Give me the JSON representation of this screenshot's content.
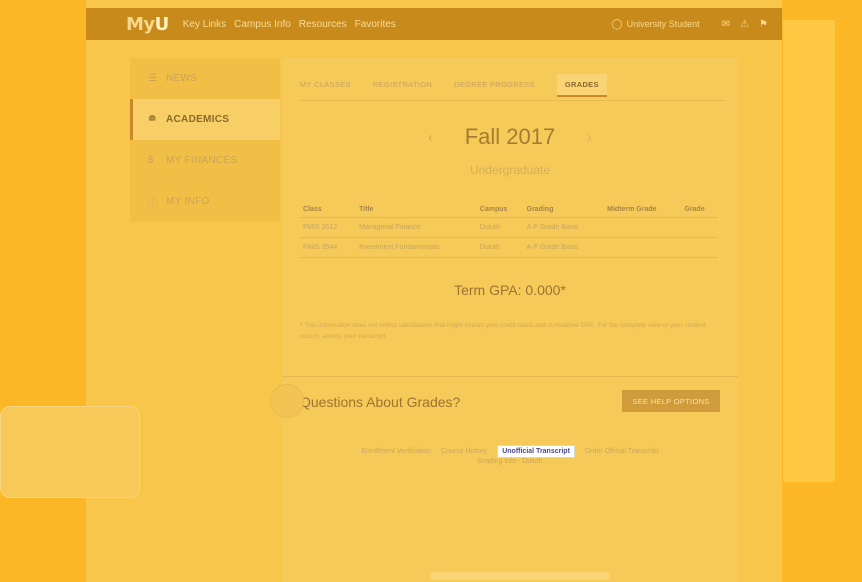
{
  "topbar": {
    "logo_prefix": "My",
    "logo_suffix": "U",
    "links": [
      "Key Links",
      "Campus Info",
      "Resources",
      "Favorites"
    ],
    "user": "University Student",
    "user_icon": "user-circle-icon",
    "icons": [
      "mail-icon",
      "alert-triangle-icon",
      "flag-icon"
    ]
  },
  "sidebar": {
    "items": [
      {
        "label": "NEWS",
        "icon": "news-icon"
      },
      {
        "label": "ACADEMICS",
        "icon": "graduation-cap-icon"
      },
      {
        "label": "MY FINANCES",
        "icon": "dollar-icon"
      },
      {
        "label": "MY INFO",
        "icon": "info-icon"
      }
    ]
  },
  "tabs": [
    "MY CLASSES",
    "REGISTRATION",
    "DEGREE PROGRESS",
    "GRADES"
  ],
  "term": {
    "title": "Fall 2017",
    "subtitle": "Undergraduate",
    "prev": "‹",
    "next": "›"
  },
  "grades_table": {
    "headers": [
      "Class",
      "Title",
      "Campus",
      "Grading",
      "Midterm Grade",
      "Grade"
    ],
    "rows": [
      [
        "FMIS 3512",
        "Managerial Finance",
        "Duluth",
        "A-F Grade Basis",
        "",
        ""
      ],
      [
        "FMIS 3544",
        "Investment Fundamentals",
        "Duluth",
        "A-F Grade Basis",
        "",
        ""
      ]
    ]
  },
  "gpa": "Term GPA: 0.000*",
  "note": "* This information does not reflect calculations that might impact your credit totals and cumulative GPA. For the complete view of your student record, access your transcript.",
  "questions": {
    "title": "Questions About Grades?",
    "button": "SEE HELP OPTIONS"
  },
  "quick_links": {
    "items": [
      "Enrollment Verification",
      "Course History",
      "Unofficial Transcript",
      "Order Official Transcript"
    ],
    "second_line": "Grading Info - Duluth"
  }
}
